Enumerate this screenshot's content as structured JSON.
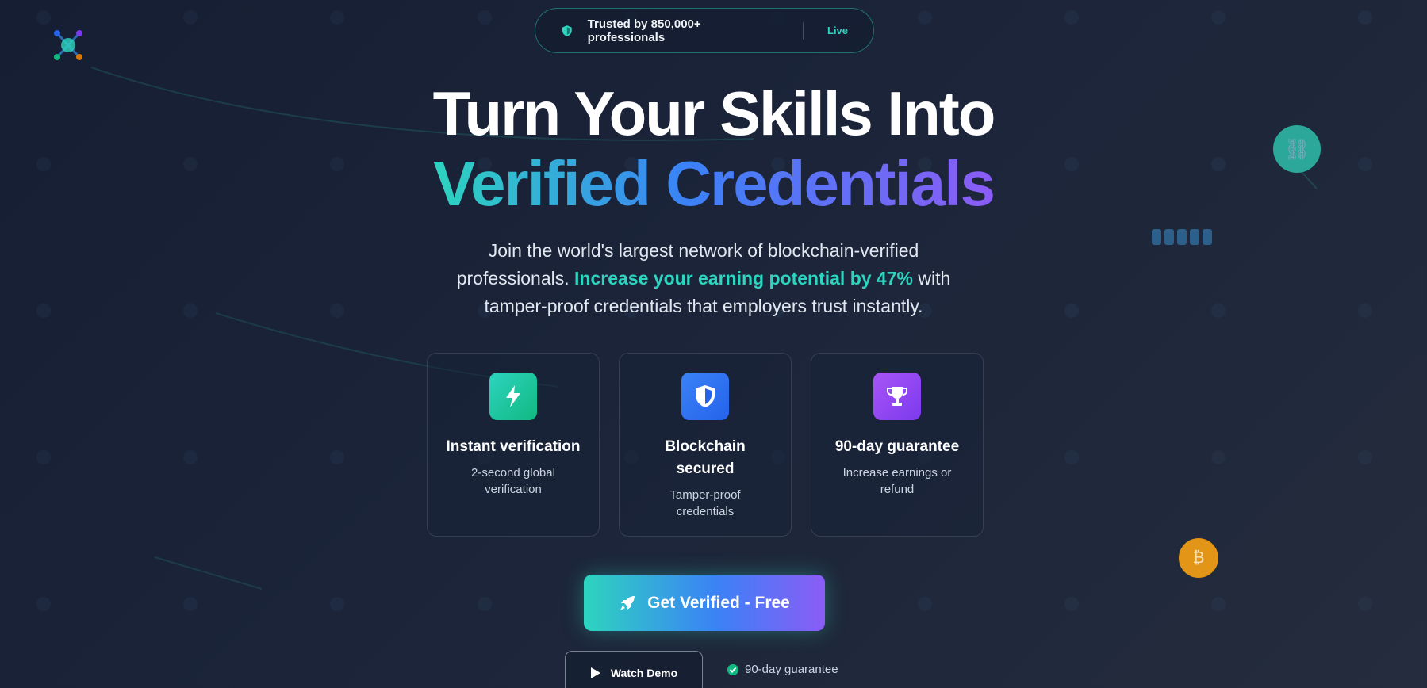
{
  "trust_badge": {
    "icon": "shield-icon",
    "text": "Trusted by 850,000+ professionals",
    "status": "Live"
  },
  "hero": {
    "headline_line1": "Turn Your Skills Into",
    "headline_line2": "Verified Credentials",
    "subtitle_part1": "Join the world's largest network of blockchain-verified professionals.",
    "subtitle_highlight": "Increase your earning potential by 47%",
    "subtitle_part2": "with tamper-proof credentials that employers trust instantly."
  },
  "features": [
    {
      "icon": "lightning-bolt-icon",
      "title": "Instant verification",
      "description": "2-second global verification"
    },
    {
      "icon": "shield-icon",
      "title": "Blockchain secured",
      "description": "Tamper-proof credentials"
    },
    {
      "icon": "trophy-icon",
      "title": "90-day guarantee",
      "description": "Increase earnings or refund"
    }
  ],
  "cta": {
    "primary_label": "Get Verified - Free",
    "primary_icon": "rocket-icon",
    "secondary_label": "Watch Demo",
    "secondary_icon": "play-icon",
    "guarantee_note": "90-day guarantee",
    "guarantee_icon": "check-circle-icon"
  },
  "decorations": {
    "bitcoin_symbol": "₿",
    "link_symbol": "⛓"
  },
  "colors": {
    "accent_teal": "#2dd4bf",
    "accent_blue": "#3b82f6",
    "accent_purple": "#8b5cf6",
    "bitcoin_orange": "#e39517",
    "background": "#1b2439"
  }
}
